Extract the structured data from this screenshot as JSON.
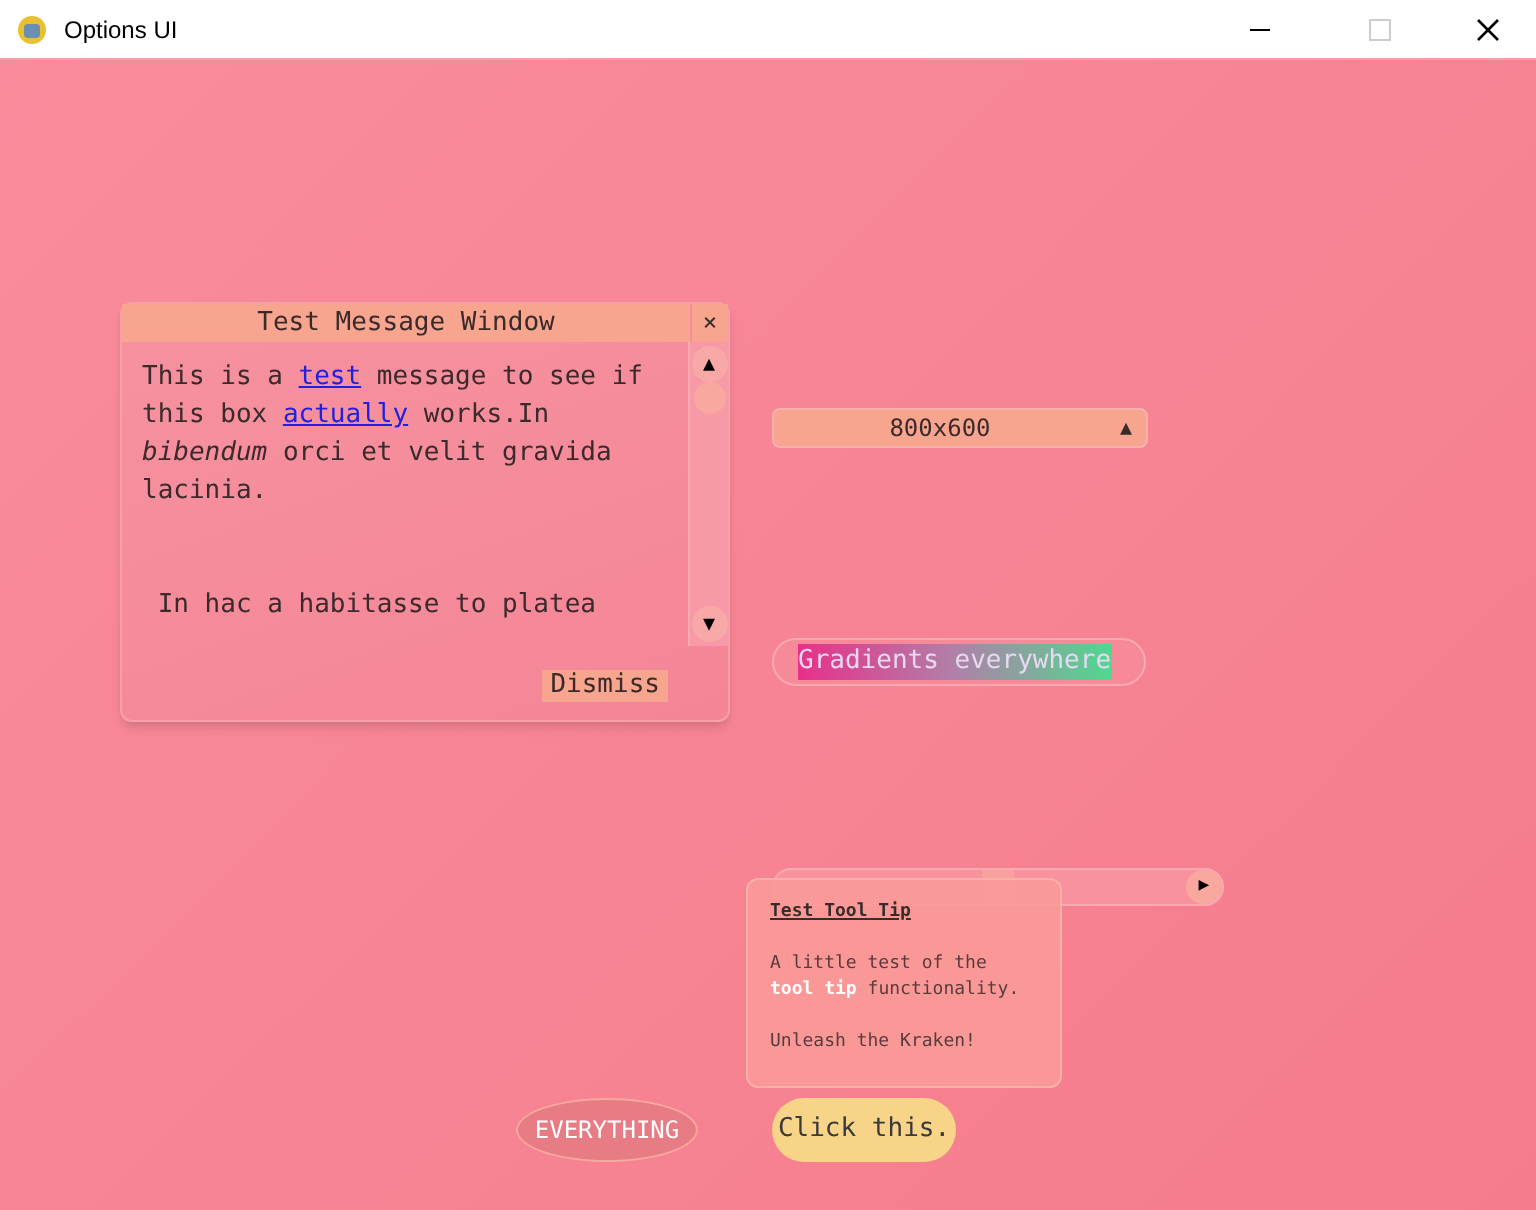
{
  "window": {
    "title": "Options UI"
  },
  "message_window": {
    "title": "Test Message Window",
    "close": "×",
    "paragraphs": [
      [
        {
          "kind": "text",
          "text": "This is a "
        },
        {
          "kind": "link",
          "text": "test"
        },
        {
          "kind": "text",
          "text": " message to see if this box "
        },
        {
          "kind": "link",
          "text": "actually"
        },
        {
          "kind": "text",
          "text": " works.In *bibendum* orci et velit gravida lacinia."
        }
      ],
      [
        {
          "kind": "text",
          "text": " In hac a habitasse to platea"
        }
      ]
    ],
    "scroll_up": "▲",
    "scroll_down": "▼",
    "button": "Dismiss"
  },
  "dropdown": {
    "value": "800x600",
    "arrow": "▲"
  },
  "text_entry": {
    "value": "Gradients everywhere",
    "selected": true
  },
  "slider": {
    "right": "▶",
    "level": 0.5
  },
  "tooltip": {
    "title": "Test Tool Tip",
    "body": "A little test of the **tool tip** functionality.",
    "footer": "Unleash the Kraken!"
  },
  "buttons": [
    {
      "label": "EVERYTHING",
      "disabled": true
    },
    {
      "label": "Click this.",
      "disabled": false
    }
  ]
}
